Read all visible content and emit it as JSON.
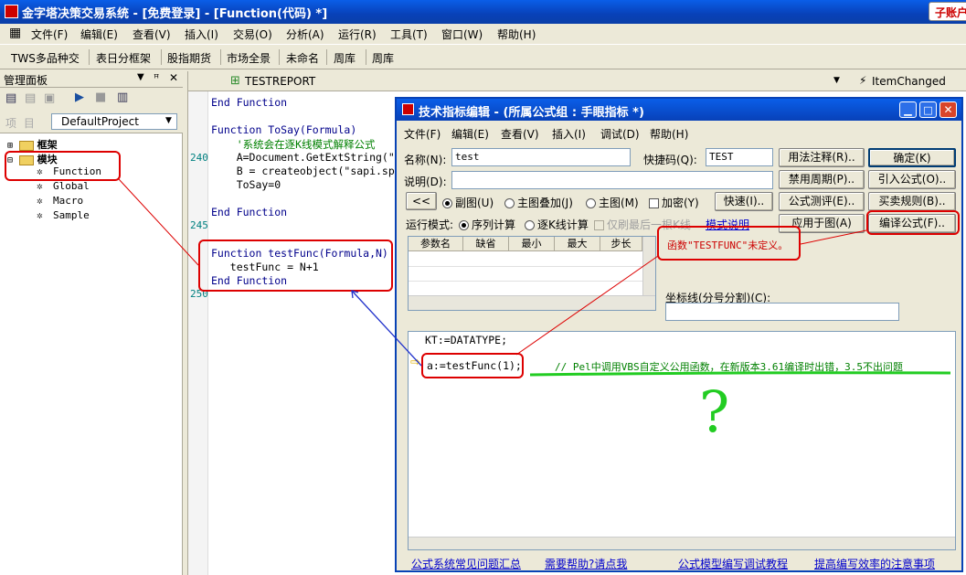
{
  "app": {
    "title": "金字塔决策交易系统 - [免费登录] - [Function(代码) *]",
    "account_button": "子账户"
  },
  "menu": [
    "文件(F)",
    "编辑(E)",
    "查看(V)",
    "插入(I)",
    "交易(O)",
    "分析(A)",
    "运行(R)",
    "工具(T)",
    "窗口(W)",
    "帮助(H)"
  ],
  "toolbar": [
    "TWS多品种交",
    "表日分框架",
    "股指期货",
    "市场全景",
    "未命名",
    "周库",
    "周库"
  ],
  "panel": {
    "title": "管理面板",
    "project_label": "项 目",
    "project_value": "DefaultProject",
    "tree": {
      "frame": "框架",
      "module": "模块",
      "items": [
        "Function",
        "Global",
        "Macro",
        "Sample"
      ]
    }
  },
  "editor": {
    "tab_name": "TESTREPORT",
    "event_combo": "ItemChanged",
    "line_numbers": [
      "240",
      "245",
      "250"
    ],
    "code_lines": [
      "End Function",
      "",
      "Function ToSay(Formula)",
      "    '系统会在逐K线模式解释公式",
      "    A=Document.GetExtString(\"",
      "    B = createobject(\"sapi.sp",
      "    ToSay=0",
      "",
      "End Function",
      "",
      "",
      "Function testFunc(Formula,N)",
      "   testFunc = N+1",
      "End Function"
    ]
  },
  "dialog": {
    "title": "技术指标编辑 - (所属公式组 : 手眼指标 *)",
    "menu": [
      "文件(F)",
      "编辑(E)",
      "查看(V)",
      "插入(I)",
      "调试(D)",
      "帮助(H)"
    ],
    "name_label": "名称(N):",
    "name_value": "test",
    "shortcut_label": "快捷码(Q):",
    "shortcut_value": "TEST",
    "desc_label": "说明(D):",
    "desc_value": "",
    "back_button": "<<",
    "radio_sub": "副图(U)",
    "radio_main_overlay": "主图叠加(J)",
    "radio_main": "主图(M)",
    "check_encrypt": "加密(Y)",
    "fast_button": "快速(I)..",
    "run_mode_label": "运行模式:",
    "run_seq": "序列计算",
    "run_kline": "逐K线计算",
    "check_last_bar": "仅刷最后一根K线",
    "mode_link": "模式说明",
    "buttons": {
      "usage": "用法注释(R)..",
      "disable_period": "禁用周期(P)..",
      "formula_test": "公式测评(E)..",
      "apply_chart": "应用于图(A)",
      "ok": "确定(K)",
      "import": "引入公式(O)..",
      "trade_rules": "买卖规则(B)..",
      "compile": "编译公式(F).."
    },
    "param_headers": [
      "参数名",
      "缺省",
      "最小",
      "最大",
      "步长"
    ],
    "error_text": "函数\"TESTFUNC\"未定义。",
    "axis_label": "坐标线(分号分割)(C):",
    "axis_value": "",
    "code": {
      "line1": "KT:=DATATYPE;",
      "line2": "a:=testFunc(1);",
      "comment": "// Pel中调用VBS自定义公用函数，在新版本3.61编译时出错，3.5不出问题"
    },
    "question_mark": "?",
    "links": [
      "公式系统常见问题汇总",
      "需要帮助?请点我",
      "公式模型编写调试教程",
      "提高编写效率的注意事项"
    ]
  },
  "colors": {
    "titlebar": "#0a5ee8",
    "annotation_red": "#dd0000",
    "annotation_green": "#22cc22",
    "arrow_blue": "#2233cc",
    "comment_green": "#008000"
  }
}
